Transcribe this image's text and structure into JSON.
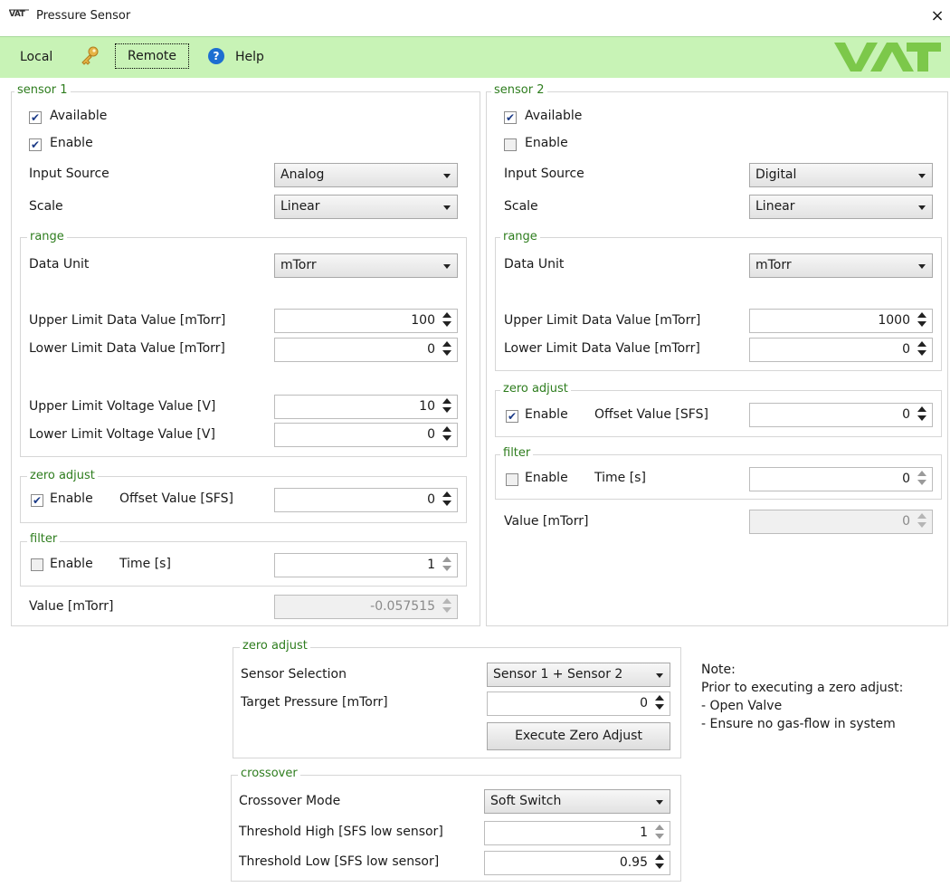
{
  "window": {
    "title": "Pressure Sensor",
    "logo_text": "VAT",
    "close_glyph": "×"
  },
  "toolbar": {
    "local_label": "Local",
    "remote_label": "Remote",
    "help_label": "Help",
    "help_glyph": "?"
  },
  "sensor1": {
    "title": "sensor 1",
    "available": {
      "label": "Available",
      "checked": true
    },
    "enable": {
      "label": "Enable",
      "checked": true
    },
    "input_source": {
      "label": "Input Source",
      "value": "Analog"
    },
    "scale": {
      "label": "Scale",
      "value": "Linear"
    },
    "range": {
      "title": "range",
      "data_unit": {
        "label": "Data Unit",
        "value": "mTorr"
      },
      "upper_data": {
        "label": "Upper Limit Data Value [mTorr]",
        "value": "100"
      },
      "lower_data": {
        "label": "Lower Limit Data Value [mTorr]",
        "value": "0"
      },
      "upper_voltage": {
        "label": "Upper Limit Voltage Value [V]",
        "value": "10"
      },
      "lower_voltage": {
        "label": "Lower Limit Voltage Value [V]",
        "value": "0"
      }
    },
    "zero_adjust": {
      "title": "zero adjust",
      "enable_label": "Enable",
      "enable_checked": true,
      "offset_label": "Offset Value [SFS]",
      "offset_value": "0"
    },
    "filter": {
      "title": "filter",
      "enable_label": "Enable",
      "enable_checked": false,
      "time_label": "Time [s]",
      "time_value": "1"
    },
    "value": {
      "label": "Value [mTorr]",
      "value": "-0.057515"
    }
  },
  "sensor2": {
    "title": "sensor 2",
    "available": {
      "label": "Available",
      "checked": true
    },
    "enable": {
      "label": "Enable",
      "checked": false
    },
    "input_source": {
      "label": "Input Source",
      "value": "Digital"
    },
    "scale": {
      "label": "Scale",
      "value": "Linear"
    },
    "range": {
      "title": "range",
      "data_unit": {
        "label": "Data Unit",
        "value": "mTorr"
      },
      "upper_data": {
        "label": "Upper Limit Data Value [mTorr]",
        "value": "1000"
      },
      "lower_data": {
        "label": "Lower Limit Data Value [mTorr]",
        "value": "0"
      }
    },
    "zero_adjust": {
      "title": "zero adjust",
      "enable_label": "Enable",
      "enable_checked": true,
      "offset_label": "Offset Value [SFS]",
      "offset_value": "0"
    },
    "filter": {
      "title": "filter",
      "enable_label": "Enable",
      "enable_checked": false,
      "time_label": "Time [s]",
      "time_value": "0"
    },
    "value": {
      "label": "Value [mTorr]",
      "value": "0"
    }
  },
  "zero_adjust": {
    "title": "zero adjust",
    "sensor_selection": {
      "label": "Sensor Selection",
      "value": "Sensor 1 + Sensor 2"
    },
    "target_pressure": {
      "label": "Target Pressure [mTorr]",
      "value": "0"
    },
    "execute_label": "Execute Zero Adjust"
  },
  "note": {
    "title": "Note:",
    "line1": "Prior to executing a zero adjust:",
    "line2": "- Open Valve",
    "line3": "- Ensure no gas-flow in system"
  },
  "crossover": {
    "title": "crossover",
    "mode": {
      "label": "Crossover Mode",
      "value": "Soft Switch"
    },
    "threshold_high": {
      "label": "Threshold High [SFS low sensor]",
      "value": "1"
    },
    "threshold_low": {
      "label": "Threshold Low [SFS low sensor]",
      "value": "0.95"
    }
  },
  "colors": {
    "toolbar_bg": "#c8f3b6",
    "group_label": "#2e7d1e",
    "logo_green": "#7cc84a",
    "help_blue": "#1d6ed1"
  }
}
